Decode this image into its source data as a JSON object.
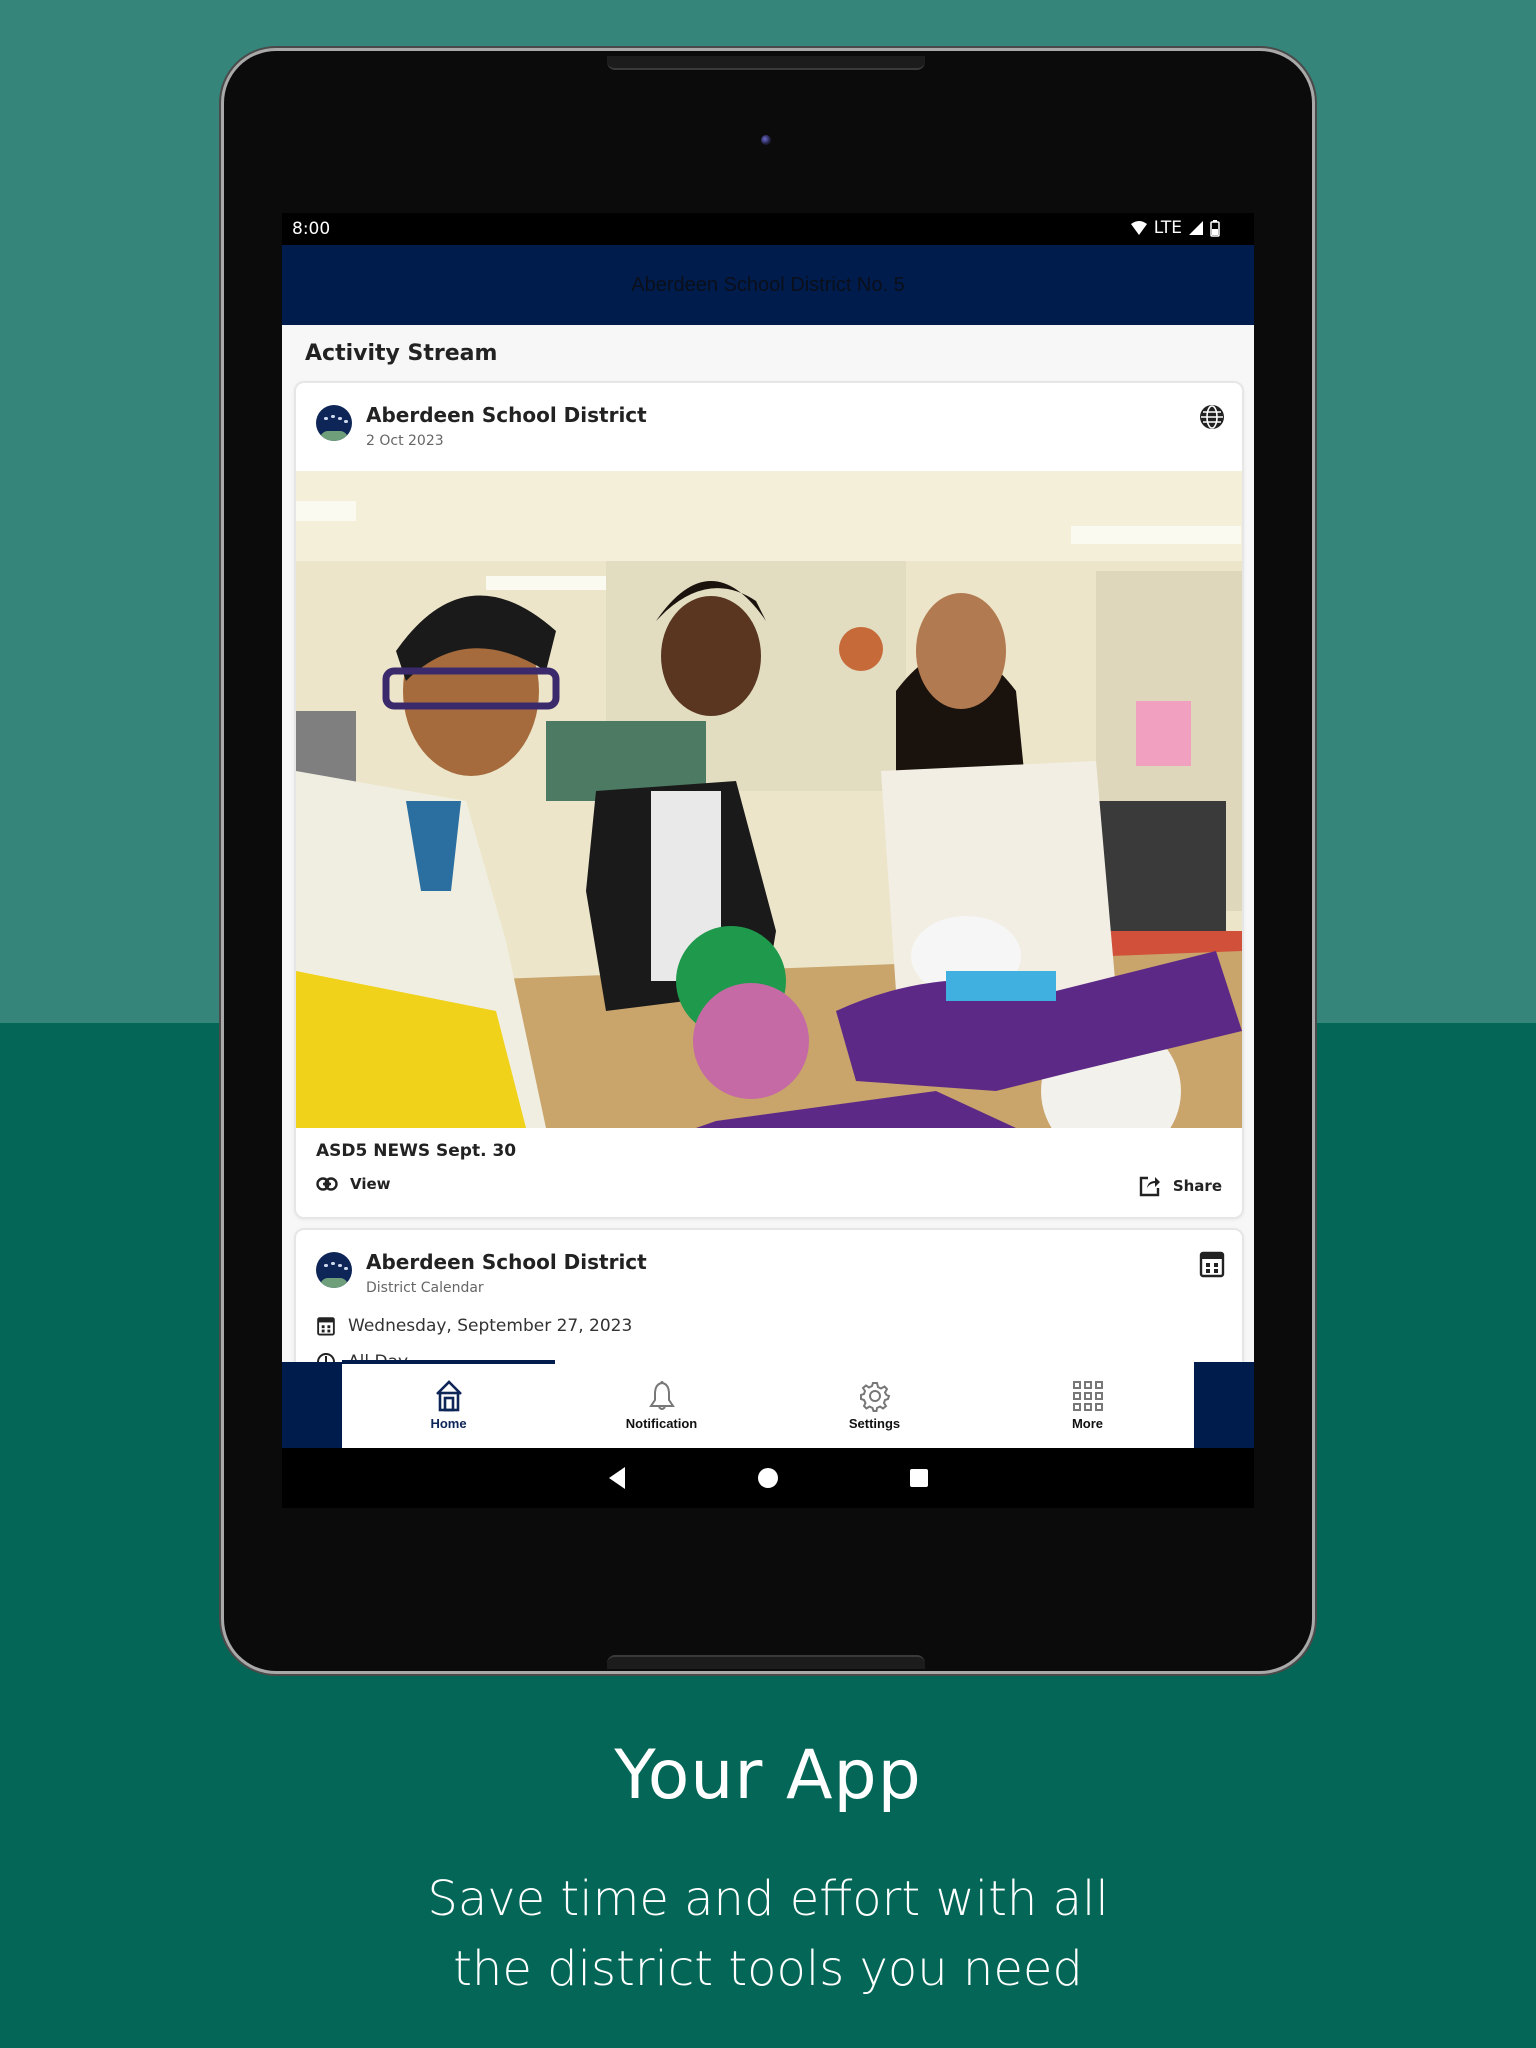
{
  "colors": {
    "background_top": "#35857a",
    "background_bottom": "#036656",
    "app_header": "#001c4d",
    "accent": "#0d2557"
  },
  "status_bar": {
    "time": "8:00",
    "network": "LTE",
    "icons": [
      "wifi-icon",
      "signal-icon",
      "battery-icon"
    ]
  },
  "app_header": {
    "title": "Aberdeen School District No. 5"
  },
  "activity_stream": {
    "title": "Activity Stream",
    "posts": [
      {
        "author": "Aberdeen School District",
        "subtitle": "2 Oct 2023",
        "type_icon": "globe-icon",
        "image_description": "Three students smiling in a classroom with balls of yarn and purple bandanas on a table",
        "title": "ASD5 NEWS Sept. 30",
        "actions": {
          "view": "View",
          "share": "Share"
        }
      },
      {
        "author": "Aberdeen School District",
        "subtitle": "District Calendar",
        "type_icon": "calendar-icon",
        "event_date": "Wednesday, September 27, 2023",
        "event_time": "All Day"
      }
    ]
  },
  "bottom_nav": {
    "items": [
      {
        "label": "Home",
        "icon": "home-icon",
        "active": true
      },
      {
        "label": "Notification",
        "icon": "bell-icon",
        "active": false
      },
      {
        "label": "Settings",
        "icon": "gear-icon",
        "active": false
      },
      {
        "label": "More",
        "icon": "grid-icon",
        "active": false
      }
    ]
  },
  "system_nav": [
    "back-icon",
    "home-circle-icon",
    "recents-icon"
  ],
  "promo": {
    "title": "Your App",
    "subtitle_line1": "Save time and effort with all",
    "subtitle_line2": "the district tools you need"
  }
}
